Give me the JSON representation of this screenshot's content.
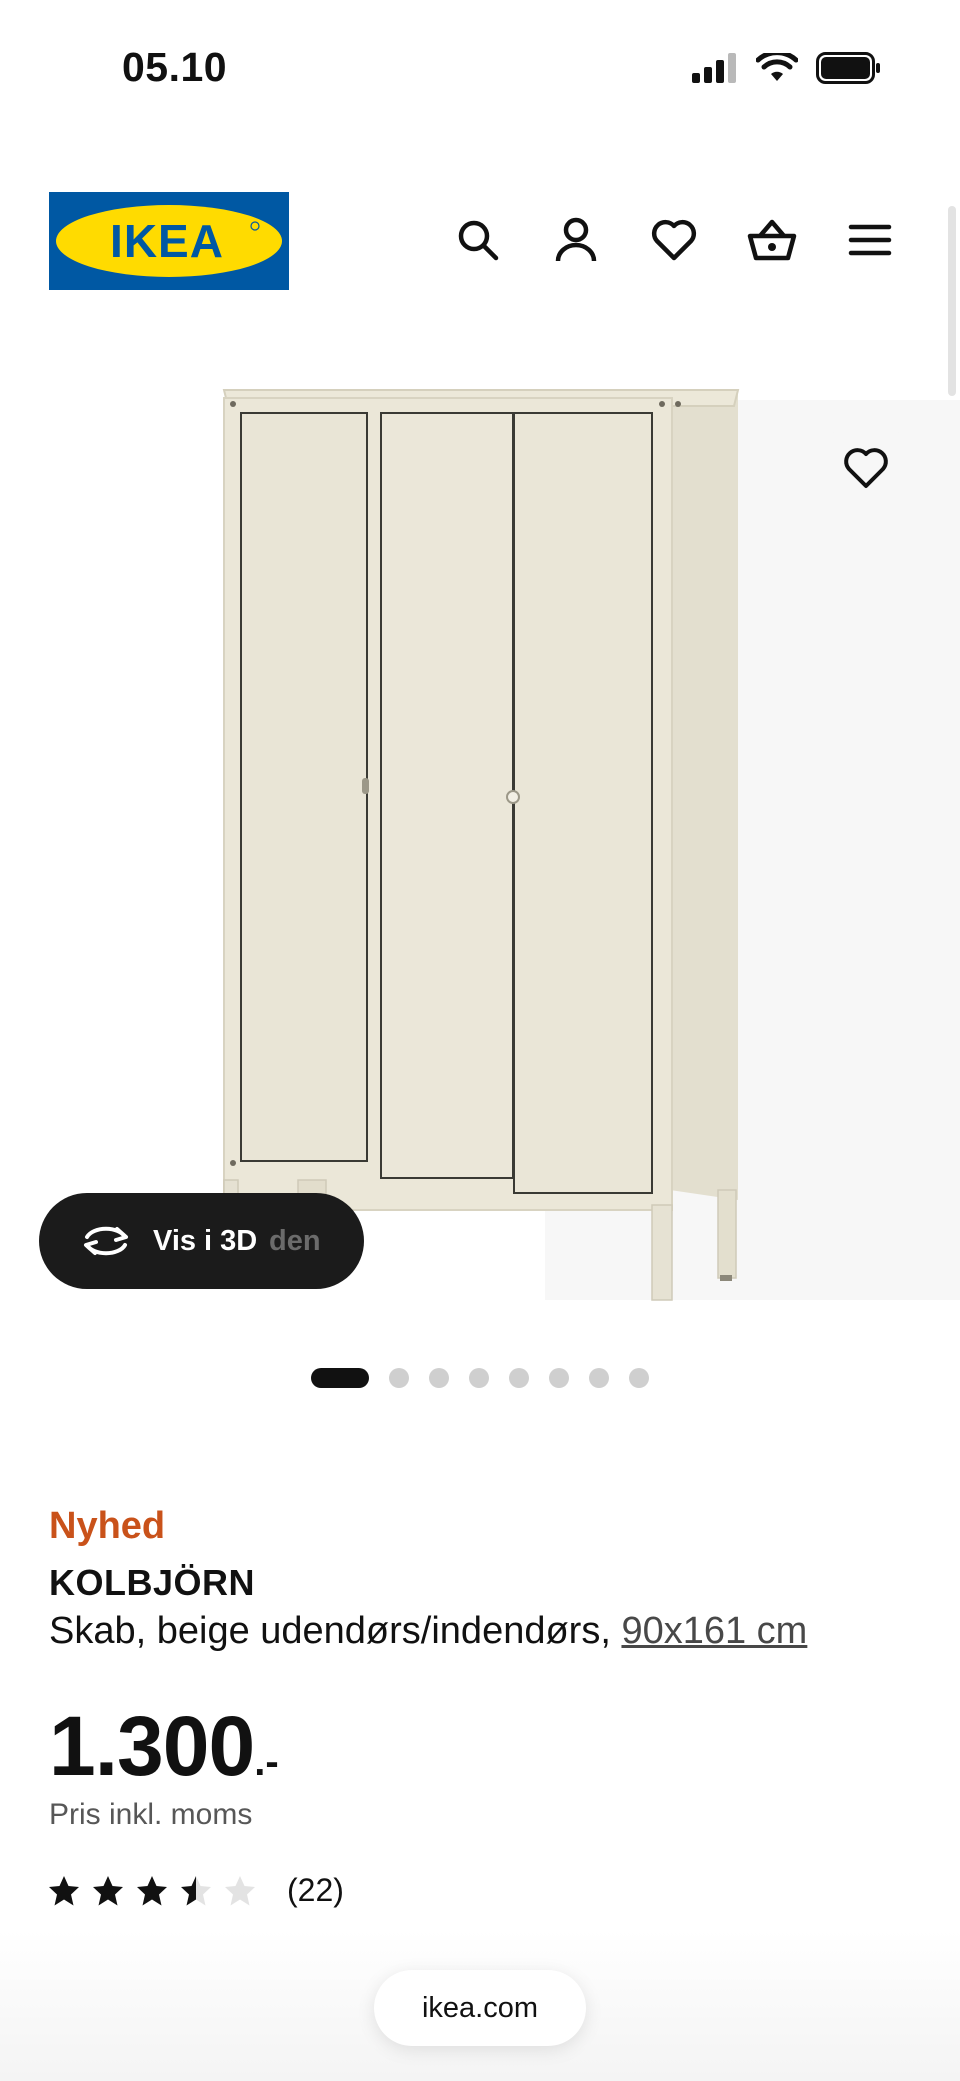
{
  "status_bar": {
    "time": "05.10"
  },
  "header": {
    "logo_text": "IKEA"
  },
  "media": {
    "view3d_label": "Vis i 3D",
    "ghost_label": "den",
    "dots_count": 8,
    "active_dot": 0
  },
  "product": {
    "badge": "Nyhed",
    "name": "KOLBJÖRN",
    "description": "Skab, beige udendørs/indendørs, ",
    "size": "90x161 cm",
    "price": "1.300",
    "price_suffix": ".-",
    "price_note": "Pris inkl. moms",
    "rating": 3.5,
    "rating_max": 5,
    "rating_count": "(22)"
  },
  "footer": {
    "domain": "ikea.com"
  },
  "colors": {
    "brand_blue": "#0058a3",
    "brand_yellow": "#ffdb00",
    "new_badge": "#c9521a",
    "cabinet": "#e9e5d6"
  }
}
